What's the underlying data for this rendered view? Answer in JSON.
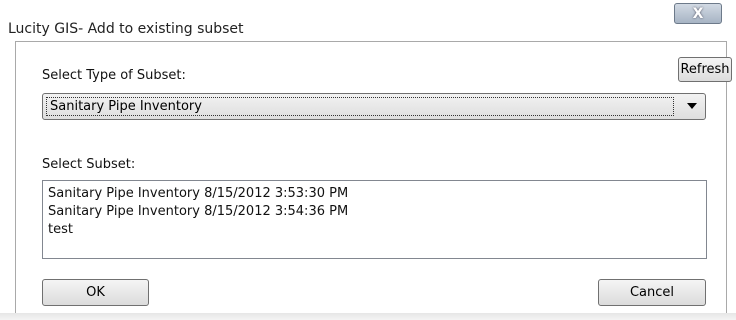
{
  "window": {
    "title": "Lucity GIS- Add to existing subset",
    "close_label": "X"
  },
  "form": {
    "refresh_label": "Refresh",
    "type_label": "Select Type of Subset:",
    "type_selected": "Sanitary Pipe Inventory",
    "subset_label": "Select Subset:",
    "subsets": [
      "Sanitary Pipe Inventory 8/15/2012 3:53:30 PM",
      "Sanitary Pipe Inventory 8/15/2012 3:54:36 PM",
      "test"
    ],
    "ok_label": "OK",
    "cancel_label": "Cancel"
  }
}
